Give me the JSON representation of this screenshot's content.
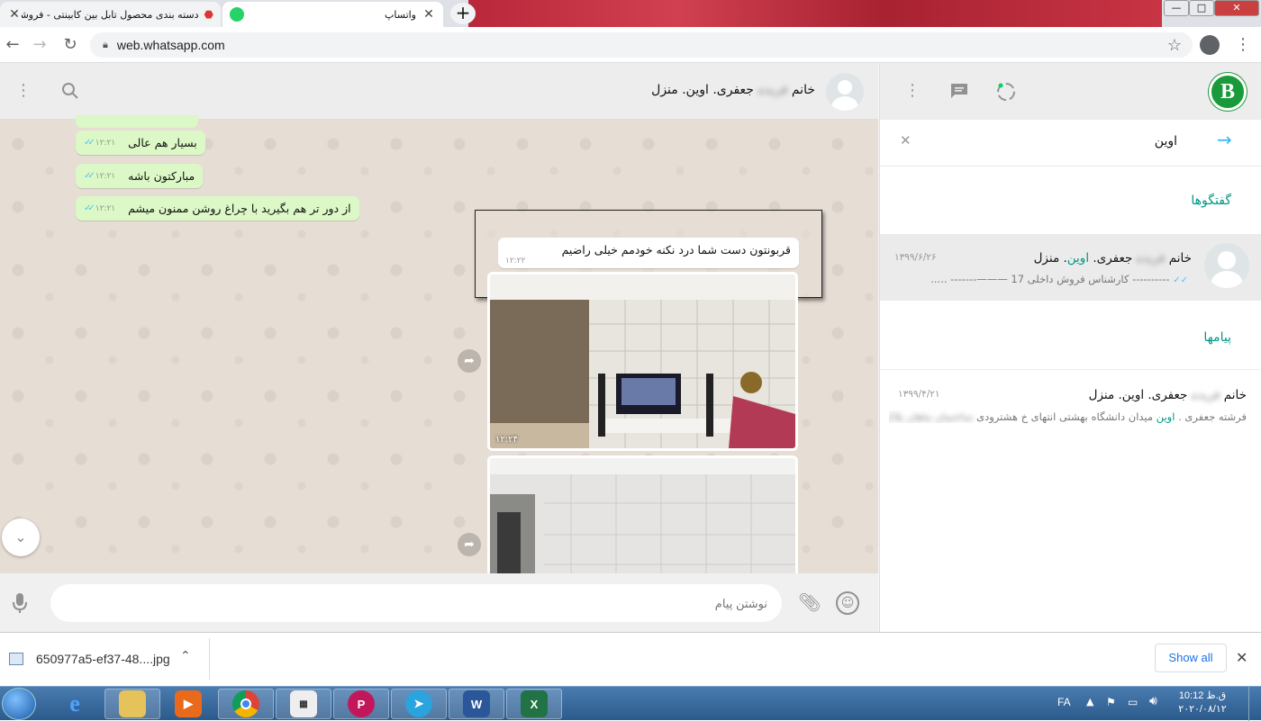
{
  "browser": {
    "tabs": [
      {
        "title": "دسته بندی محصول تابل بین کابینتی - فروشگ",
        "active": false
      },
      {
        "title": "واتساپ",
        "active": true
      }
    ],
    "url": "web.whatsapp.com"
  },
  "chat": {
    "contact_name_prefix": "خانم",
    "contact_name_blurred": "فریده",
    "contact_name_suffix": "جعفری. اوین. منزل",
    "messages": [
      {
        "text": "بسیار هم عالی",
        "time": "۱۲:۲۱"
      },
      {
        "text": "مبارکتون باشه",
        "time": "۱۲:۲۱"
      },
      {
        "text": "از دور تر هم بگیرید با چراغ روشن ممنون میشم",
        "time": "۱۲:۲۱"
      }
    ],
    "incoming": {
      "text": "قربونتون دست شما درد نکنه خودمم خیلی راضیم",
      "time": "۱۲:۲۲"
    },
    "photo_time": "۱۲:۲۴",
    "composer_placeholder": "نوشتن پیام"
  },
  "sidebar": {
    "search_value": "اوین",
    "section_chats": "گفتگوها",
    "section_messages": "پیامها",
    "chat_result": {
      "name_prefix": "خانم",
      "name_blurred": "فریده",
      "name_mid": "جعفری.",
      "name_hl": "اوین",
      "name_suffix": ". منزل",
      "date": "۱۳۹۹/۶/۲۶",
      "snippet": "---------- کارشناس فروش داخلی 17 ———------- .....",
      "snippet_dash": "-----------"
    },
    "message_result": {
      "name_prefix": "خانم",
      "name_blurred": "فریده",
      "name_suffix": "جعفری. اوین. منزل",
      "date": "۱۳۹۹/۴/۲۱",
      "snippet_a": "فرشته جعفری .",
      "snippet_hl": "اوین",
      "snippet_b": "میدان دانشگاه بهشتی انتهای خ هشترودی",
      "snippet_blur": "ساختمان ماهان پلاک"
    }
  },
  "downloads": {
    "file_name": "650977a5-ef37-48....jpg",
    "show_all": "Show all"
  },
  "taskbar": {
    "lang": "FA",
    "time": "ق.ظ 10:12",
    "date": "۲۰۲۰/۰۸/۱۲"
  },
  "colors": {
    "accent": "#009688",
    "bubble_out": "#dcf8c6",
    "wallpaper": "#e6ddd4"
  }
}
